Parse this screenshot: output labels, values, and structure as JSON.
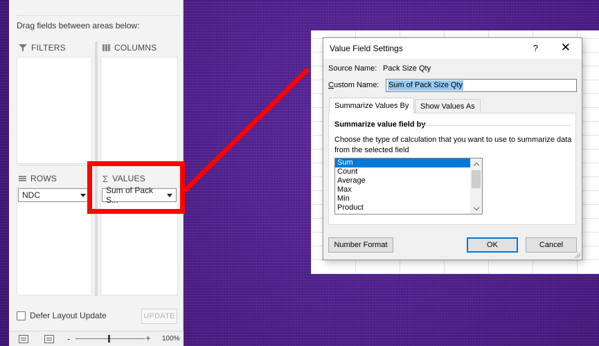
{
  "field_pane": {
    "drag_hint": "Drag fields between areas below:",
    "areas": {
      "filters": {
        "label": "FILTERS",
        "icon": "filter-icon"
      },
      "columns": {
        "label": "COLUMNS",
        "icon": "columns-icon"
      },
      "rows": {
        "label": "ROWS",
        "icon": "rows-icon",
        "fields": [
          "NDC"
        ]
      },
      "values": {
        "label": "VALUES",
        "icon": "sigma-icon",
        "fields": [
          "Sum of Pack S..."
        ]
      }
    },
    "values_icon_glyph": "Σ",
    "defer_layout_label": "Defer Layout Update",
    "defer_checked": false,
    "update_label": "UPDATE",
    "zoom": {
      "minus": "-",
      "plus": "+",
      "percent": "100%",
      "level_fraction": 0.5
    }
  },
  "annotation": {
    "color": "#ff0000"
  },
  "dialog": {
    "title": "Value Field Settings",
    "help_label": "?",
    "close_label": "✕",
    "source_name_label": "Source Name:",
    "source_name_value": "Pack Size Qty",
    "custom_name_label": "Custom Name:",
    "custom_name_value": "Sum of Pack Size Qty",
    "tabs": [
      {
        "label": "Summarize Values By",
        "active": true
      },
      {
        "label": "Show Values As",
        "active": false
      }
    ],
    "section_heading": "Summarize value field by",
    "description": "Choose the type of calculation that you want to use to summarize data from the selected field",
    "calc_options": [
      "Sum",
      "Count",
      "Average",
      "Max",
      "Min",
      "Product"
    ],
    "selected_option": "Sum",
    "number_format_label": "Number Format",
    "ok_label": "OK",
    "cancel_label": "Cancel"
  },
  "colors": {
    "background": "#4b1a86",
    "selection_blue": "#0078d7",
    "text_selection": "#99c9ef"
  }
}
